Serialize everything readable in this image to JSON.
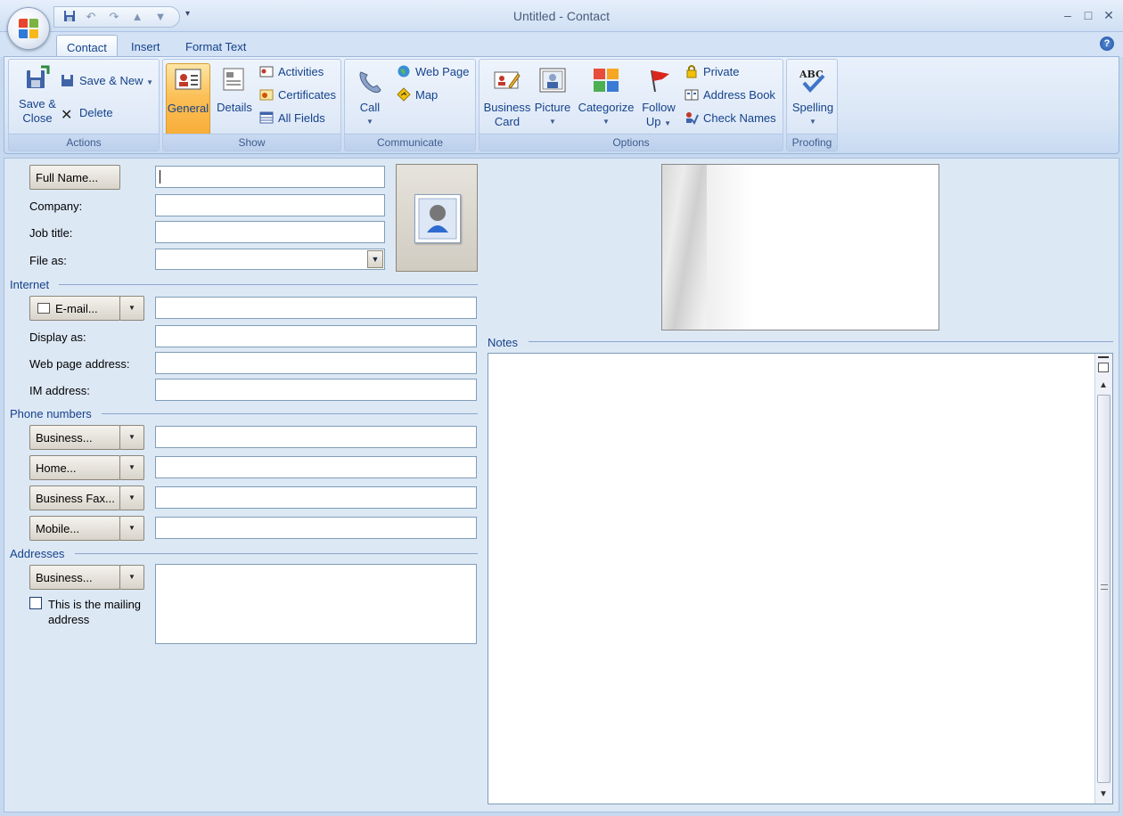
{
  "window": {
    "title": "Untitled",
    "title_sep": "-",
    "title_type": "Contact",
    "minimize": "–",
    "restore": "□",
    "close": "✕"
  },
  "qat": {
    "save_icon": "save-icon",
    "undo_icon": "undo-icon",
    "redo_icon": "redo-icon",
    "prev_icon": "previous-item-icon",
    "next_icon": "next-item-icon",
    "customize": "▾"
  },
  "tabs": [
    {
      "label": "Contact"
    },
    {
      "label": "Insert"
    },
    {
      "label": "Format Text"
    }
  ],
  "help": "?",
  "ribbon": {
    "actions": {
      "label": "Actions",
      "save_close_1": "Save &",
      "save_close_2": "Close",
      "save_new": "Save & New",
      "delete": "Delete"
    },
    "show": {
      "label": "Show",
      "general": "General",
      "details": "Details",
      "activities": "Activities",
      "certificates": "Certificates",
      "all_fields": "All Fields"
    },
    "communicate": {
      "label": "Communicate",
      "call": "Call",
      "web_page": "Web Page",
      "map": "Map"
    },
    "options": {
      "label": "Options",
      "business_card_1": "Business",
      "business_card_2": "Card",
      "picture": "Picture",
      "categorize": "Categorize",
      "follow_up_1": "Follow",
      "follow_up_2": "Up",
      "private": "Private",
      "address_book": "Address Book",
      "check_names": "Check Names"
    },
    "proofing": {
      "label": "Proofing",
      "spelling": "Spelling"
    }
  },
  "form": {
    "full_name": "Full Name...",
    "company": "Company:",
    "job_title": "Job title:",
    "file_as": "File as:",
    "internet": "Internet",
    "email": "E-mail...",
    "display_as": "Display as:",
    "web_page_address": "Web page address:",
    "im_address": "IM address:",
    "phone_numbers": "Phone numbers",
    "phone_business": "Business...",
    "phone_home": "Home...",
    "phone_business_fax": "Business Fax...",
    "phone_mobile": "Mobile...",
    "addresses": "Addresses",
    "address_business": "Business...",
    "mailing_1": "This is the mailing",
    "mailing_2": "address",
    "notes": "Notes"
  },
  "colors": {
    "accent": "#15428b",
    "ribbon_bg": "#dbe7f6",
    "active_tab": "#f8ad38",
    "form_bg": "#dde8f5"
  }
}
